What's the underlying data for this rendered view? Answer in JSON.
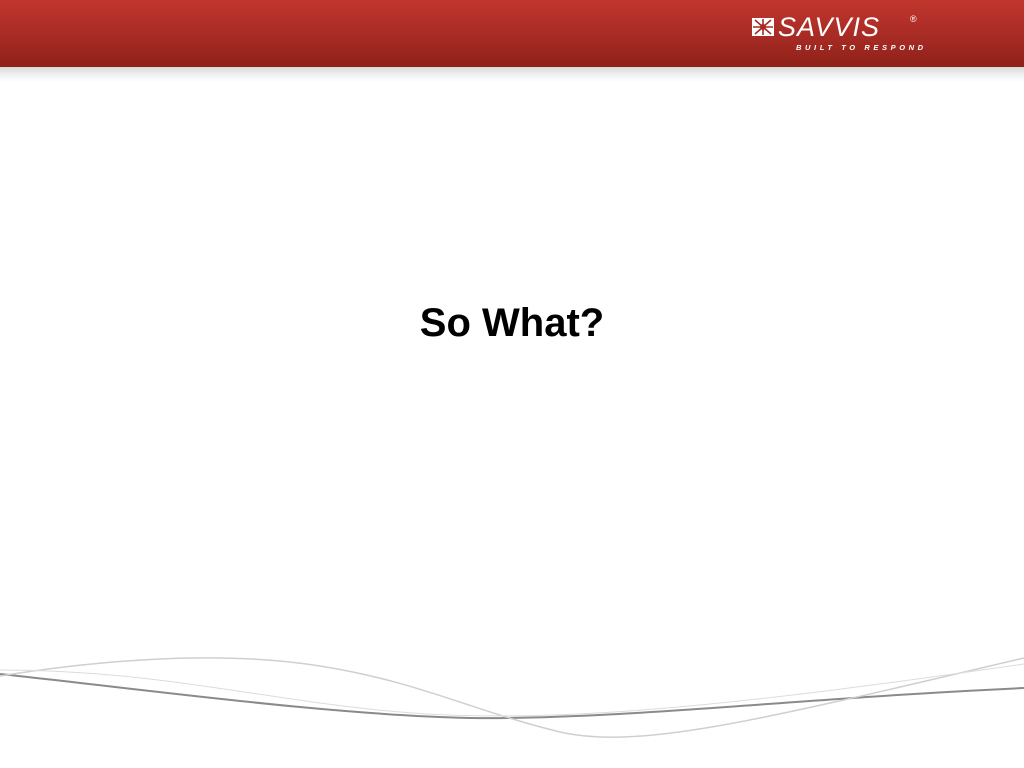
{
  "header": {
    "color": "#a72b24",
    "logo": {
      "name": "SAVVIS",
      "registered_mark": "®",
      "tagline": "BUILT TO RESPOND",
      "icon": "savvis-star-icon"
    }
  },
  "slide": {
    "title": "So What?"
  },
  "footer": {
    "decoration": "swoosh-lines"
  }
}
